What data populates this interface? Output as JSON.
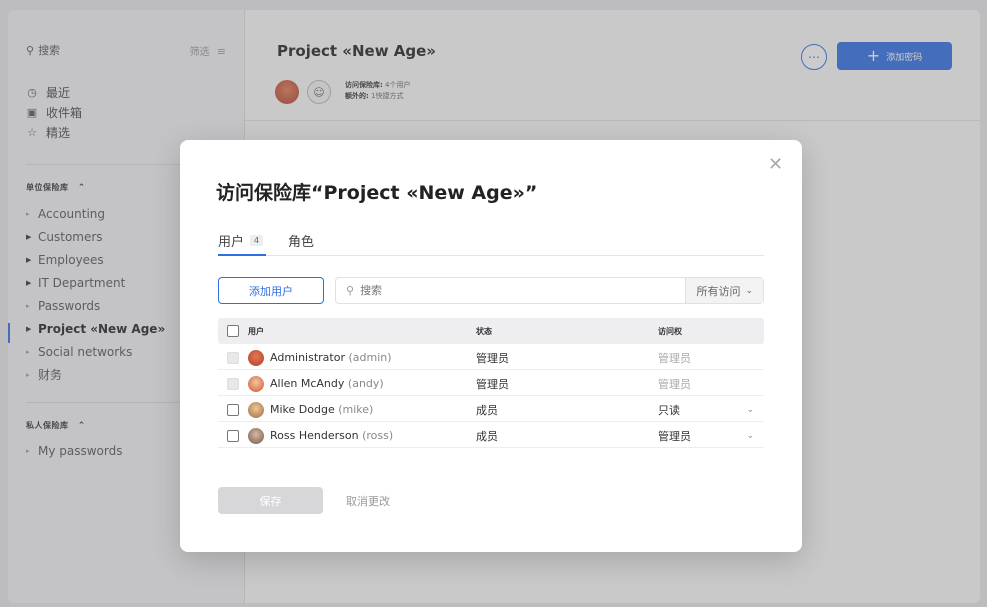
{
  "sidebar": {
    "search_label": "搜索",
    "filter_label": "筛选",
    "nav": [
      {
        "label": "最近",
        "icon": "clock-icon"
      },
      {
        "label": "收件箱",
        "icon": "inbox-icon"
      },
      {
        "label": "精选",
        "icon": "star-icon"
      }
    ],
    "shared_section_title": "单位保险库",
    "shared_vaults": [
      {
        "label": "Accounting",
        "expandable": false
      },
      {
        "label": "Customers",
        "expandable": true
      },
      {
        "label": "Employees",
        "expandable": true
      },
      {
        "label": "IT Department",
        "expandable": true
      },
      {
        "label": "Passwords",
        "expandable": false
      },
      {
        "label": "Project «New Age»",
        "expandable": true,
        "active": true
      },
      {
        "label": "Social networks",
        "expandable": false
      },
      {
        "label": "财务",
        "expandable": false
      }
    ],
    "private_section_title": "私人保险库",
    "private_vaults": [
      {
        "label": "My passwords",
        "expandable": false
      }
    ]
  },
  "main": {
    "title": "Project «New Age»",
    "access_line1_label": "访问保险库:",
    "access_line1_value": "4个用户",
    "access_line2_label": "额外的:",
    "access_line2_value": "1快捷方式",
    "add_password_label": "添加密码"
  },
  "modal": {
    "title": "访问保险库“Project «New Age»”",
    "tabs": [
      {
        "label": "用户",
        "count": "4",
        "active": true
      },
      {
        "label": "角色",
        "count": "",
        "active": false
      }
    ],
    "add_user_label": "添加用户",
    "search_placeholder": "搜索",
    "filter_value": "所有访问",
    "columns": {
      "user": "用户",
      "status": "状态",
      "access": "访问权"
    },
    "rows": [
      {
        "name": "Administrator",
        "login": "(admin)",
        "status": "管理员",
        "access": "管理员",
        "editable": false
      },
      {
        "name": "Allen McAndy",
        "login": "(andy)",
        "status": "管理员",
        "access": "管理员",
        "editable": false
      },
      {
        "name": "Mike Dodge",
        "login": "(mike)",
        "status": "成员",
        "access": "只读",
        "editable": true
      },
      {
        "name": "Ross Henderson",
        "login": "(ross)",
        "status": "成员",
        "access": "管理员",
        "editable": true
      }
    ],
    "save_label": "保存",
    "cancel_label": "取消更改"
  },
  "colors": {
    "accent": "#2f6fe3",
    "muted": "#aaaaaa"
  }
}
